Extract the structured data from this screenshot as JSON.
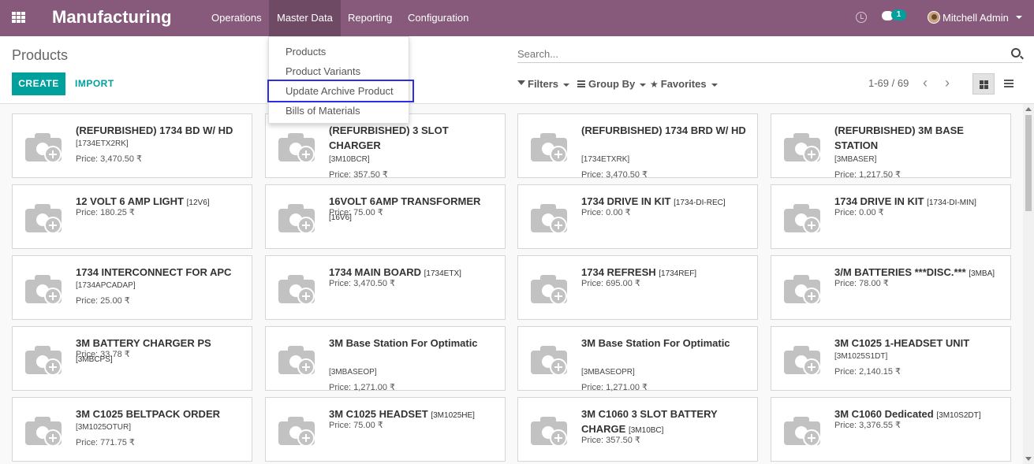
{
  "navbar": {
    "app_name": "Manufacturing",
    "menu": [
      "Operations",
      "Master Data",
      "Reporting",
      "Configuration"
    ],
    "active_menu": "Master Data",
    "chat_count": "1",
    "user_name": "Mitchell Admin",
    "brand_color": "#875a7b"
  },
  "dropdown": {
    "items": [
      "Products",
      "Product Variants",
      "Update Archive Product",
      "Bills of Materials"
    ],
    "highlighted": "Update Archive Product"
  },
  "control_panel": {
    "breadcrumb": "Products",
    "create_label": "CREATE",
    "import_label": "IMPORT",
    "search_placeholder": "Search...",
    "filters_label": "Filters",
    "groupby_label": "Group By",
    "favorites_label": "Favorites",
    "pager": "1-69 / 69",
    "accent_color": "#00a09d"
  },
  "products": [
    {
      "title": "(REFURBISHED) 1734 BD W/ HD",
      "code": "",
      "ref": "[1734ETX2RK]",
      "price": "Price: 3,470.50 ₹"
    },
    {
      "title": "(REFURBISHED) 3 SLOT CHARGER",
      "code": "",
      "ref": "[3M10BCR]",
      "price": "Price: 357.50 ₹"
    },
    {
      "title": "(REFURBISHED) 1734 BRD W/ HD",
      "code": "",
      "ref": "[1734ETXRK]",
      "price": "Price: 3,470.50 ₹"
    },
    {
      "title": "(REFURBISHED) 3M BASE STATION",
      "code": "",
      "ref": "[3MBASER]",
      "price": "Price: 1,217.50 ₹"
    },
    {
      "title": "12 VOLT 6 AMP LIGHT",
      "code": "[12V6]",
      "ref": "",
      "price": "Price: 180.25 ₹"
    },
    {
      "title": "16VOLT 6AMP TRANSFORMER",
      "code": "[16V6]",
      "ref": "",
      "price": "Price: 75.00 ₹"
    },
    {
      "title": "1734 DRIVE IN KIT",
      "code": "[1734-DI-REC]",
      "ref": "",
      "price": "Price: 0.00 ₹"
    },
    {
      "title": "1734 DRIVE IN KIT",
      "code": "[1734-DI-MIN]",
      "ref": "",
      "price": "Price: 0.00 ₹"
    },
    {
      "title": "1734 INTERCONNECT FOR APC",
      "code": "",
      "ref": "[1734APCADAP]",
      "price": "Price: 25.00 ₹"
    },
    {
      "title": "1734 MAIN BOARD",
      "code": "[1734ETX]",
      "ref": "",
      "price": "Price: 3,470.50 ₹"
    },
    {
      "title": "1734 REFRESH",
      "code": "[1734REF]",
      "ref": "",
      "price": "Price: 695.00 ₹"
    },
    {
      "title": "3/M BATTERIES ***DISC.***",
      "code": "[3MBA]",
      "ref": "",
      "price": "Price: 78.00 ₹"
    },
    {
      "title": "3M BATTERY CHARGER PS",
      "code": "[3MBCPS]",
      "ref": "",
      "price": "Price: 33.78 ₹"
    },
    {
      "title": "3M Base Station For Optimatic",
      "code": "",
      "ref": "[3MBASEOP]",
      "price": "Price: 1,271.00 ₹"
    },
    {
      "title": "3M Base Station For Optimatic",
      "code": "",
      "ref": "[3MBASEOPR]",
      "price": "Price: 1,271.00 ₹"
    },
    {
      "title": "3M C1025 1-HEADSET UNIT",
      "code": "",
      "ref": "[3M1025S1DT]",
      "price": "Price: 2,140.15 ₹"
    },
    {
      "title": "3M C1025 BELTPACK ORDER",
      "code": "",
      "ref": "[3M1025OTUR]",
      "price": "Price: 771.75 ₹"
    },
    {
      "title": "3M C1025 HEADSET",
      "code": "[3M1025HE]",
      "ref": "",
      "price": "Price: 75.00 ₹"
    },
    {
      "title": "3M C1060 3 SLOT BATTERY CHARGE",
      "code": "[3M10BC]",
      "ref": "",
      "price": "Price: 357.50 ₹"
    },
    {
      "title": "3M C1060 Dedicated",
      "code": "[3M10S2DT]",
      "ref": "",
      "price": "Price: 3,376.55 ₹"
    }
  ]
}
